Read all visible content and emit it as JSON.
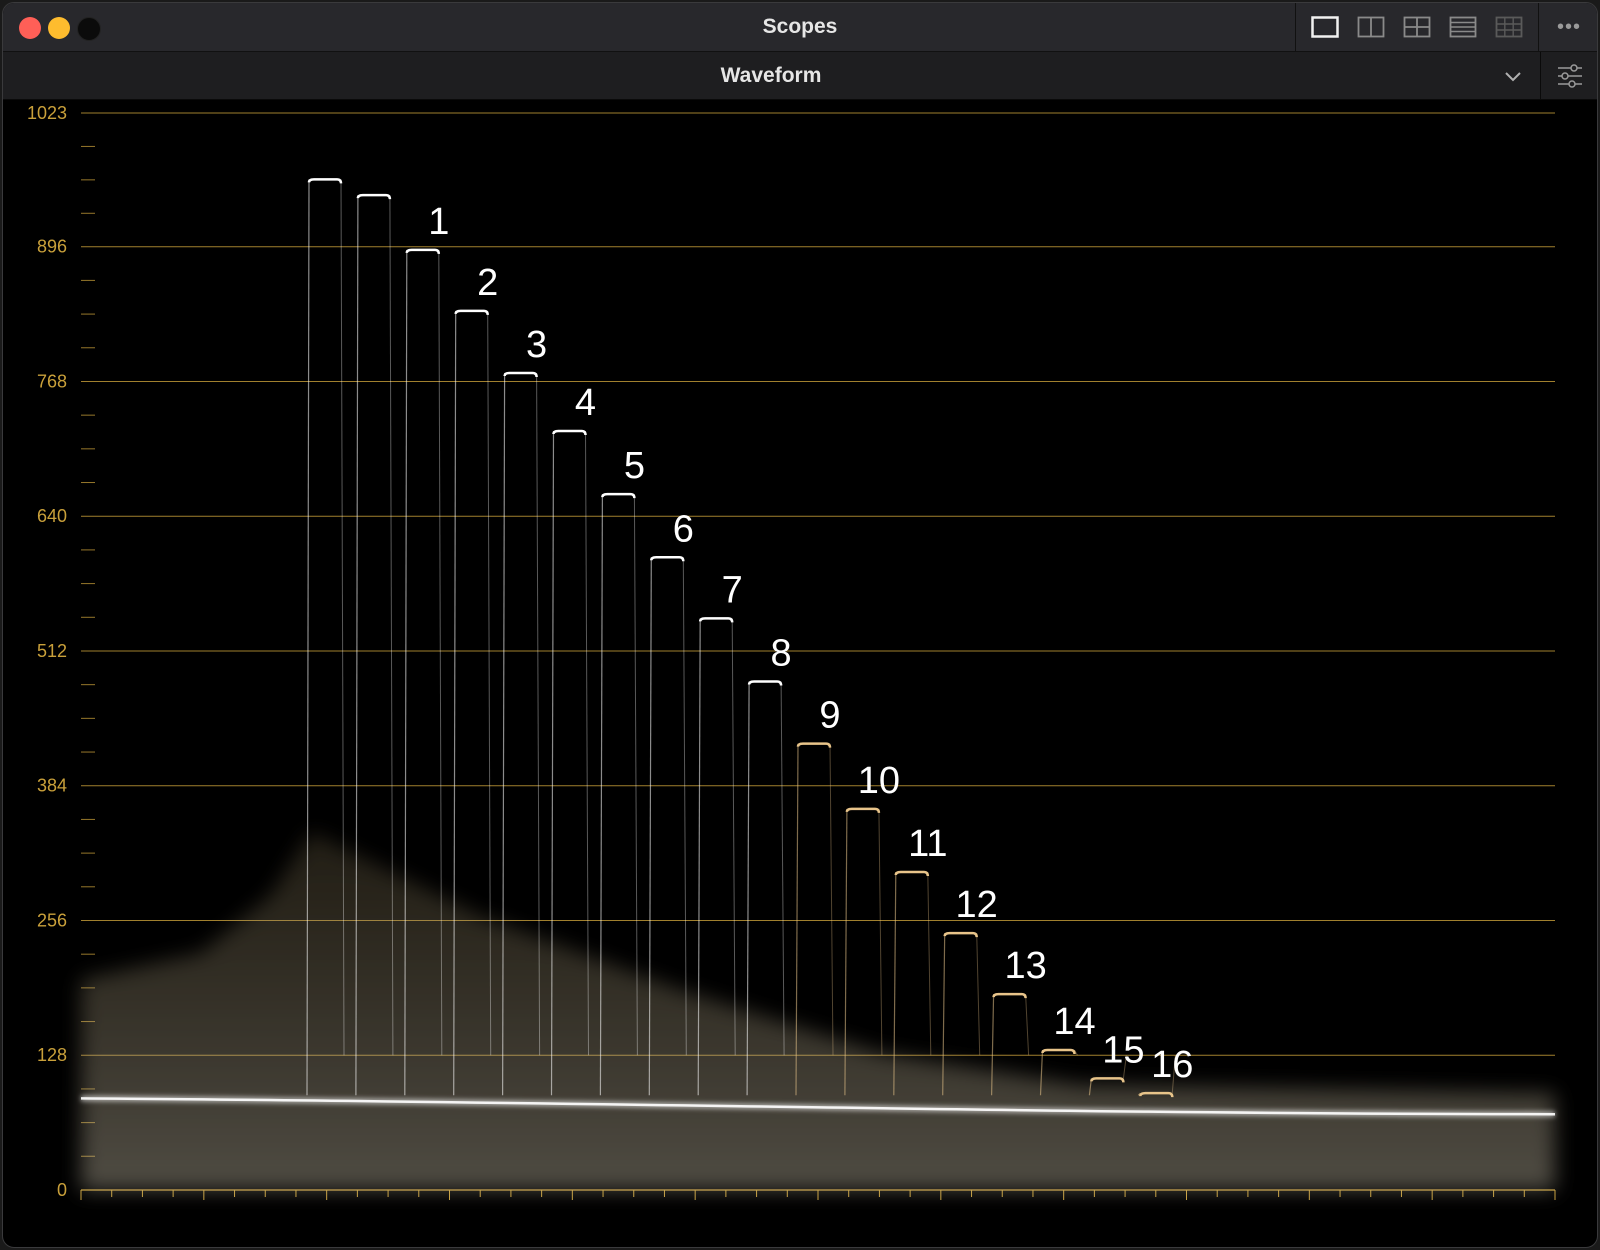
{
  "window": {
    "title": "Scopes"
  },
  "toolbar": {
    "layouts": [
      {
        "name": "single-layout-icon",
        "active": true
      },
      {
        "name": "two-up-layout-icon",
        "active": false
      },
      {
        "name": "quad-layout-icon",
        "active": false
      },
      {
        "name": "rows-layout-icon",
        "active": false
      },
      {
        "name": "grid-layout-icon",
        "active": false
      }
    ],
    "more_label": "•••"
  },
  "scope": {
    "selected": "Waveform"
  },
  "colors": {
    "graticule": "#c9a03a",
    "trace": "#ffffff",
    "trace_warm": "#e8c48a"
  },
  "chart_data": {
    "type": "waveform",
    "ylim": [
      0,
      1023
    ],
    "y_ticks": [
      0,
      128,
      256,
      384,
      512,
      640,
      768,
      896,
      1023
    ],
    "base_floor": 82,
    "steps": [
      {
        "label": "",
        "top": 960
      },
      {
        "label": "",
        "top": 945
      },
      {
        "label": "1",
        "top": 893
      },
      {
        "label": "2",
        "top": 835
      },
      {
        "label": "3",
        "top": 776
      },
      {
        "label": "4",
        "top": 721
      },
      {
        "label": "5",
        "top": 661
      },
      {
        "label": "6",
        "top": 601
      },
      {
        "label": "7",
        "top": 543
      },
      {
        "label": "8",
        "top": 483
      },
      {
        "label": "9",
        "top": 424
      },
      {
        "label": "10",
        "top": 362
      },
      {
        "label": "11",
        "top": 302
      },
      {
        "label": "12",
        "top": 244
      },
      {
        "label": "13",
        "top": 186
      },
      {
        "label": "14",
        "top": 133
      },
      {
        "label": "15",
        "top": 106
      },
      {
        "label": "16",
        "top": 92
      }
    ]
  }
}
